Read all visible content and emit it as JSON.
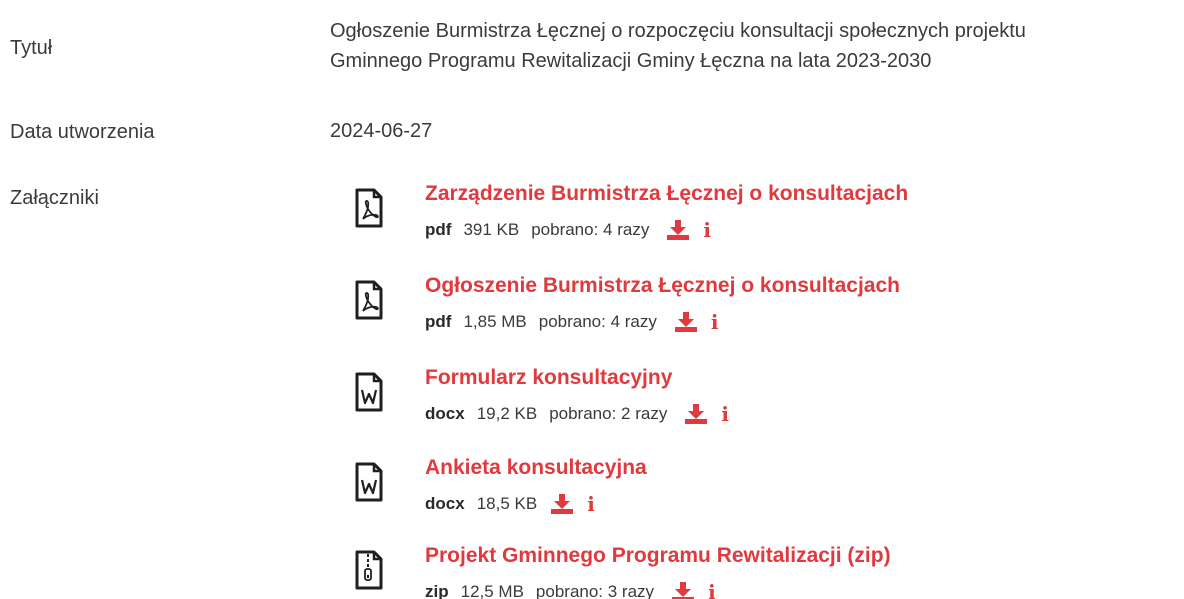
{
  "details": {
    "title_label": "Tytuł",
    "title_value_line1": "Ogłoszenie Burmistrza Łęcznej o rozpoczęciu konsultacji społecznych projektu",
    "title_value_line2": "Gminnego Programu Rewitalizacji Gminy Łęczna na lata 2023-2030",
    "date_label": "Data utworzenia",
    "date_value": "2024-06-27",
    "attachments_label": "Załączniki"
  },
  "attachments": [
    {
      "name": "Zarządzenie Burmistrza Łęcznej o konsultacjach",
      "ext": "pdf",
      "size": "391 KB",
      "downloads": "pobrano: 4 razy",
      "icon": "pdf-file-icon"
    },
    {
      "name": "Ogłoszenie Burmistrza Łęcznej o konsultacjach",
      "ext": "pdf",
      "size": "1,85 MB",
      "downloads": "pobrano: 4 razy",
      "icon": "pdf-file-icon"
    },
    {
      "name": "Formularz konsultacyjny",
      "ext": "docx",
      "size": "19,2 KB",
      "downloads": "pobrano: 2 razy",
      "icon": "word-file-icon"
    },
    {
      "name": "Ankieta konsultacyjna",
      "ext": "docx",
      "size": "18,5 KB",
      "downloads": "",
      "icon": "word-file-icon"
    },
    {
      "name": "Projekt Gminnego Programu Rewitalizacji (zip)",
      "ext": "zip",
      "size": "12,5 MB",
      "downloads": "pobrano: 3 razy",
      "icon": "zip-file-icon"
    }
  ],
  "icons": {
    "download": "download-icon",
    "info": "info-icon",
    "info_glyph": "i"
  },
  "colors": {
    "accent": "#e0393e",
    "text": "#3b3b3b"
  }
}
